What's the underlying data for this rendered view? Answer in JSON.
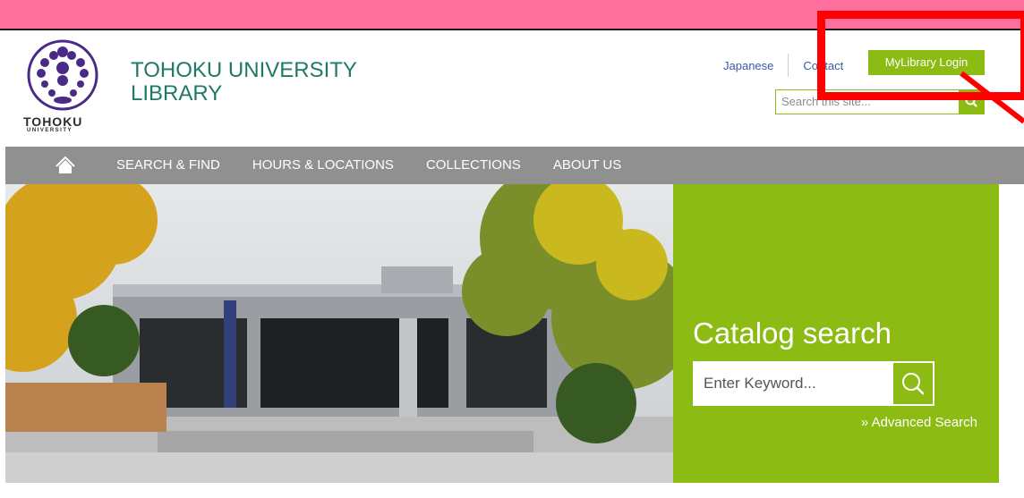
{
  "logo": {
    "wordmark": "TOHOKU",
    "sub": "UNIVERSITY"
  },
  "site": {
    "title_line1": "TOHOKU UNIVERSITY",
    "title_line2": "LIBRARY"
  },
  "util": {
    "japanese": "Japanese",
    "contact": "Contact",
    "login": "MyLibrary Login"
  },
  "site_search": {
    "placeholder": "Search this site..."
  },
  "nav": {
    "home_icon": "home-icon",
    "items": [
      "SEARCH & FIND",
      "HOURS & LOCATIONS",
      "COLLECTIONS",
      "ABOUT US"
    ]
  },
  "catalog": {
    "title": "Catalog search",
    "placeholder": "Enter Keyword...",
    "advanced": "» Advanced Search"
  },
  "colors": {
    "accent": "#8cbb14",
    "topbar": "#fd6f9c",
    "nav": "#909090",
    "title": "#1e7a67",
    "highlight": "#ff0000"
  }
}
